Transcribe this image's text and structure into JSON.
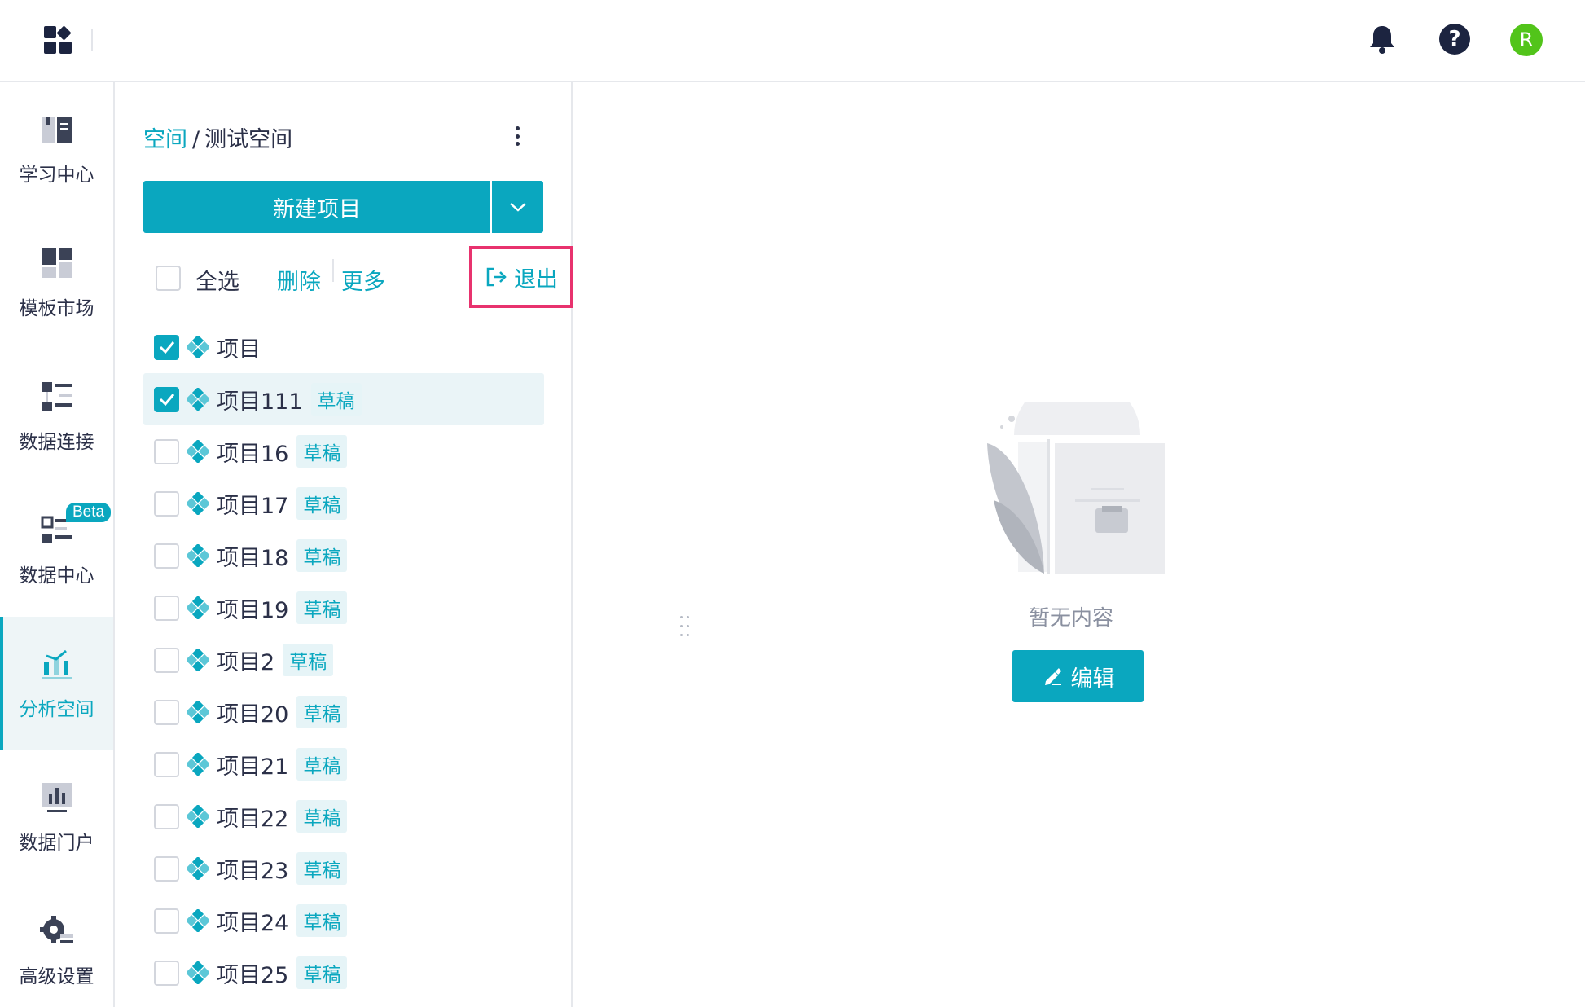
{
  "header": {
    "logo_icon": "apps-grid-icon",
    "notification_icon": "bell-icon",
    "help_icon": "question-circle-icon",
    "help_glyph": "?",
    "avatar_letter": "R",
    "avatar_color": "#52c41a"
  },
  "sidebar": {
    "items": [
      {
        "label": "学习中心",
        "icon": "book-icon"
      },
      {
        "label": "模板市场",
        "icon": "template-grid-icon"
      },
      {
        "label": "数据连接",
        "icon": "data-connection-icon"
      },
      {
        "label": "数据中心",
        "icon": "data-center-icon",
        "badge": "Beta"
      },
      {
        "label": "分析空间",
        "icon": "analysis-chart-icon",
        "active": true
      },
      {
        "label": "数据门户",
        "icon": "portal-bar-chart-icon"
      },
      {
        "label": "高级设置",
        "icon": "gear-settings-icon"
      }
    ]
  },
  "panel": {
    "breadcrumb": {
      "root": "空间",
      "separator": "/",
      "current": "测试空间"
    },
    "new_button_label": "新建项目",
    "toolbar": {
      "select_all": "全选",
      "delete": "删除",
      "more": "更多",
      "exit": "退出"
    },
    "projects": [
      {
        "name": "项目",
        "checked": true,
        "selected": false,
        "tag": ""
      },
      {
        "name": "项目111",
        "checked": true,
        "selected": true,
        "tag": "草稿"
      },
      {
        "name": "项目16",
        "checked": false,
        "selected": false,
        "tag": "草稿"
      },
      {
        "name": "项目17",
        "checked": false,
        "selected": false,
        "tag": "草稿"
      },
      {
        "name": "项目18",
        "checked": false,
        "selected": false,
        "tag": "草稿"
      },
      {
        "name": "项目19",
        "checked": false,
        "selected": false,
        "tag": "草稿"
      },
      {
        "name": "项目2",
        "checked": false,
        "selected": false,
        "tag": "草稿"
      },
      {
        "name": "项目20",
        "checked": false,
        "selected": false,
        "tag": "草稿"
      },
      {
        "name": "项目21",
        "checked": false,
        "selected": false,
        "tag": "草稿"
      },
      {
        "name": "项目22",
        "checked": false,
        "selected": false,
        "tag": "草稿"
      },
      {
        "name": "项目23",
        "checked": false,
        "selected": false,
        "tag": "草稿"
      },
      {
        "name": "项目24",
        "checked": false,
        "selected": false,
        "tag": "草稿"
      },
      {
        "name": "项目25",
        "checked": false,
        "selected": false,
        "tag": "草稿"
      }
    ]
  },
  "main": {
    "empty_text": "暂无内容",
    "edit_button_label": "编辑"
  },
  "colors": {
    "accent": "#0aa7bf",
    "highlight_border": "#e8326e",
    "nav_dark": "#1c2440"
  }
}
